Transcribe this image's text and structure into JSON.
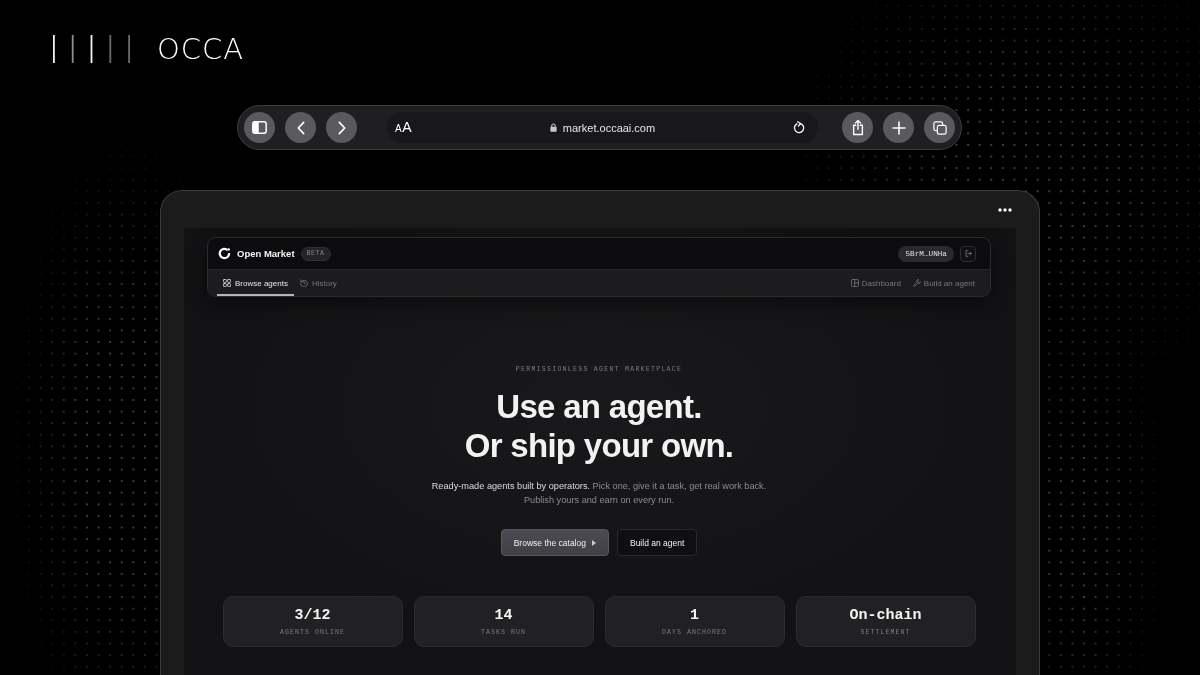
{
  "brand": {
    "wordmark": "OCCA"
  },
  "browser": {
    "text_size": "AA",
    "url": "market.occaai.com"
  },
  "app": {
    "name": "Open Market",
    "badge": "BETA",
    "wallet": "5BrM…UNHa",
    "tabs": [
      {
        "label": "Browse agents",
        "selected": true
      },
      {
        "label": "History",
        "selected": false
      }
    ],
    "actions": [
      {
        "label": "Dashboard"
      },
      {
        "label": "Build an agent"
      }
    ]
  },
  "hero": {
    "eyebrow": "PERMISSIONLESS AGENT MARKETPLACE",
    "title": "Use an agent.\nOr ship your own.",
    "subtitle": "**Ready-made agents built by operators.** Pick one, give it a task, get real work back. Publish yours and earn on every run.",
    "buttons": [
      {
        "label": "Browse the catalog",
        "kind": "primary"
      },
      {
        "label": "Build an agent",
        "kind": "secondary"
      }
    ]
  },
  "stats": [
    {
      "value": "3/12",
      "label": "AGENTS ONLINE"
    },
    {
      "value": "14",
      "label": "TASKS RUN"
    },
    {
      "value": "1",
      "label": "DAYS ANCHORED"
    },
    {
      "value": "On-chain",
      "label": "SETTLEMENT"
    }
  ]
}
